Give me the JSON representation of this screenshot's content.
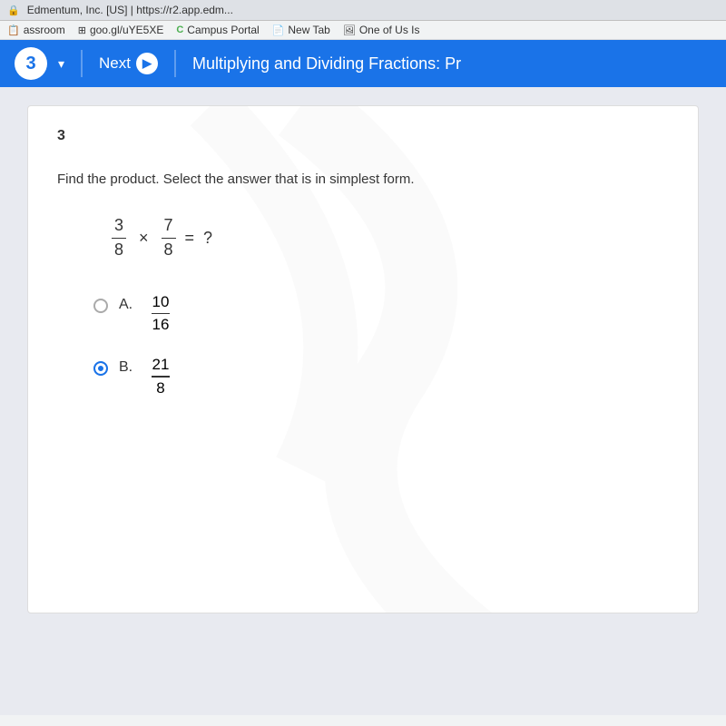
{
  "browser": {
    "lock_icon": "🔒",
    "url": "Edmentum, Inc. [US] | https://r2.app.edm...",
    "bookmarks": [
      {
        "id": "classroom",
        "label": "assroom",
        "icon": "📋"
      },
      {
        "id": "goo-gl",
        "label": "goo.gl/uYE5XE",
        "icon": "⊞"
      },
      {
        "id": "campus-portal",
        "label": "Campus Portal",
        "icon": "C"
      },
      {
        "id": "new-tab",
        "label": "New Tab",
        "icon": "📄"
      },
      {
        "id": "one-of-us",
        "label": "One of Us Is",
        "icon": "🖼"
      }
    ]
  },
  "app_nav": {
    "question_number": "3",
    "next_label": "Next",
    "page_title": "Multiplying and Dividing Fractions: Pr"
  },
  "question": {
    "number": "3",
    "instructions": "Find the product. Select the answer that is in simplest form.",
    "expression": {
      "fraction1_numerator": "3",
      "fraction1_denominator": "8",
      "operator": "×",
      "fraction2_numerator": "7",
      "fraction2_denominator": "8",
      "equals": "=",
      "question_mark": "?"
    },
    "choices": [
      {
        "id": "A",
        "label": "A.",
        "numerator": "10",
        "denominator": "16",
        "selected": false
      },
      {
        "id": "B",
        "label": "B.",
        "numerator": "21",
        "denominator": "8",
        "selected": true
      }
    ]
  },
  "colors": {
    "primary_blue": "#1a73e8",
    "nav_bg": "#1a73e8",
    "page_bg": "#e8eaf0"
  }
}
